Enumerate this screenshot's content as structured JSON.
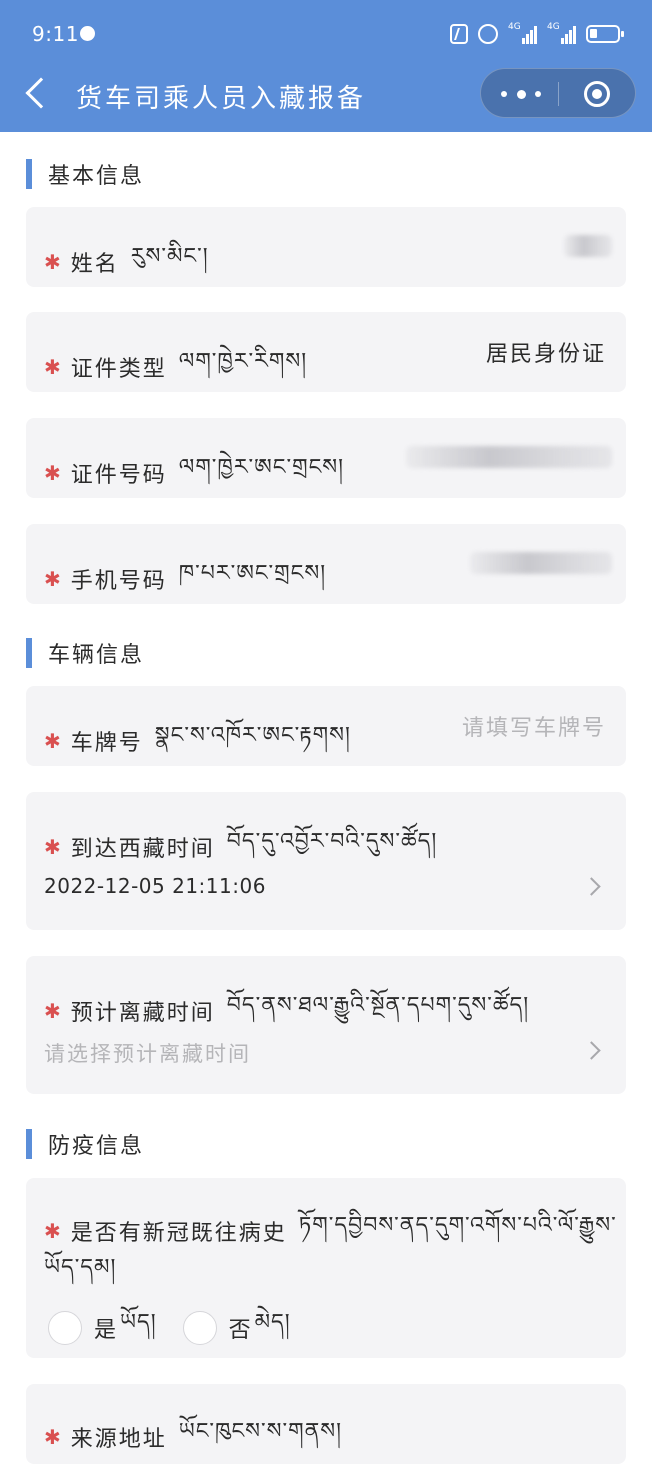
{
  "status_bar": {
    "time": "9:11",
    "network1": "4G",
    "network2": "4G"
  },
  "header": {
    "title": "货车司乘人员入藏报备",
    "back_icon": "back-icon",
    "more_icon": "more-icon",
    "target_icon": "target-icon"
  },
  "sections": {
    "basic": "基本信息",
    "vehicle": "车辆信息",
    "epidemic": "防疫信息"
  },
  "fields": {
    "name": {
      "label": "姓名",
      "tibetan": "རུས་མིང་།",
      "value_hidden": true
    },
    "id_type": {
      "label": "证件类型",
      "tibetan": "ལག་ཁྱེར་རིགས།",
      "value": "居民身份证"
    },
    "id_number": {
      "label": "证件号码",
      "tibetan": "ལག་ཁྱེར་ཨང་གྲངས།",
      "value_hidden": true
    },
    "phone": {
      "label": "手机号码",
      "tibetan": "ཁ་པར་ཨང་གྲངས།",
      "value_hidden": true
    },
    "plate": {
      "label": "车牌号",
      "tibetan": "སྣང་ས་འཁོར་ཨང་རྟགས།",
      "placeholder": "请填写车牌号"
    },
    "arrival": {
      "label": "到达西藏时间",
      "tibetan": "བོད་དུ་འབྱོར་བའི་དུས་ཚོད།",
      "value": "2022-12-05 21:11:06"
    },
    "departure": {
      "label": "预计离藏时间",
      "tibetan": "བོད་ནས་ཐལ་རྒྱུའི་སྔོན་དཔག་དུས་ཚོད།",
      "placeholder": "请选择预计离藏时间"
    },
    "covid_history": {
      "label": "是否有新冠既往病史",
      "tibetan_line1": "ཏོག་དབྱིབས་ནད་དུག་འགོས་པའི་ལོ་རྒྱུས་",
      "tibetan_line2": "ཡོད་དམ།",
      "options": [
        {
          "label": "是",
          "tibetan": "ཡོད།"
        },
        {
          "label": "否",
          "tibetan": "མེད།"
        }
      ]
    },
    "origin": {
      "label": "来源地址",
      "tibetan": "ཡོང་ཁུངས་ས་གནས།"
    }
  },
  "colors": {
    "accent": "#5b8ed9",
    "required": "#d95050",
    "card_bg": "#f4f4f6",
    "placeholder": "#b5b5b8"
  }
}
